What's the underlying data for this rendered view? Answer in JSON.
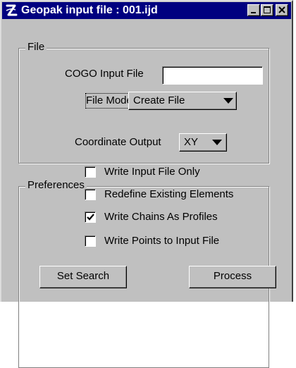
{
  "window": {
    "title": "Geopak input file : 001.ijd",
    "colors": {
      "titlebar": "#000080",
      "face": "#c0c0c0"
    },
    "controls": {
      "minimize_icon": "minimize-icon",
      "maximize_icon": "maximize-icon",
      "close_icon": "close-icon"
    }
  },
  "file_group": {
    "legend": "File",
    "cogo_label": "COGO Input File",
    "cogo_value": "",
    "mode_label": "File Mode",
    "mode_value": "Create File"
  },
  "prefs_group": {
    "legend": "Preferences",
    "coord_label": "Coordinate Output",
    "coord_value": "XY",
    "options": [
      {
        "label": "Write Input File Only",
        "checked": false
      },
      {
        "label": "Redefine Existing Elements",
        "checked": false
      },
      {
        "label": "Write Chains As Profiles",
        "checked": true
      },
      {
        "label": "Write Points to Input File",
        "checked": false
      }
    ]
  },
  "buttons": {
    "set_search": "Set Search",
    "process": "Process"
  }
}
